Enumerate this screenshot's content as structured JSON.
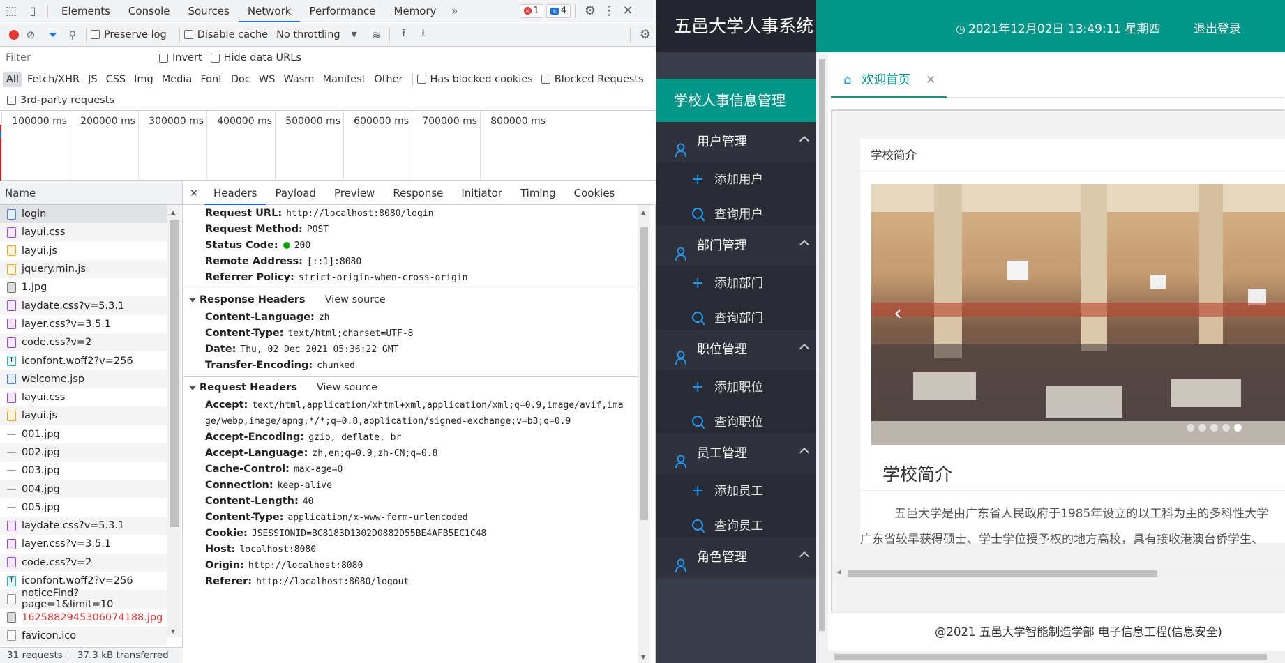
{
  "devtools": {
    "main_tabs": [
      "Elements",
      "Console",
      "Sources",
      "Network",
      "Performance",
      "Memory"
    ],
    "active_tab": "Network",
    "error_count": "1",
    "message_count": "4",
    "toolbar": {
      "preserve_log": "Preserve log",
      "disable_cache": "Disable cache",
      "throttling": "No throttling"
    },
    "filter": {
      "placeholder": "Filter",
      "invert": "Invert",
      "hide_data_urls": "Hide data URLs",
      "types": [
        "All",
        "Fetch/XHR",
        "JS",
        "CSS",
        "Img",
        "Media",
        "Font",
        "Doc",
        "WS",
        "Wasm",
        "Manifest",
        "Other"
      ],
      "active_type": "All",
      "has_blocked_cookies": "Has blocked cookies",
      "blocked_requests": "Blocked Requests",
      "third_party": "3rd-party requests"
    },
    "timeline_ticks": [
      "100000 ms",
      "200000 ms",
      "300000 ms",
      "400000 ms",
      "500000 ms",
      "600000 ms",
      "700000 ms",
      "800000 ms"
    ],
    "name_header": "Name",
    "requests": [
      {
        "name": "login",
        "type": "doc",
        "selected": true
      },
      {
        "name": "layui.css",
        "type": "css"
      },
      {
        "name": "layui.js",
        "type": "js"
      },
      {
        "name": "jquery.min.js",
        "type": "js"
      },
      {
        "name": "1.jpg",
        "type": "img"
      },
      {
        "name": "laydate.css?v=5.3.1",
        "type": "css"
      },
      {
        "name": "layer.css?v=3.5.1",
        "type": "css"
      },
      {
        "name": "code.css?v=2",
        "type": "css"
      },
      {
        "name": "iconfont.woff2?v=256",
        "type": "font"
      },
      {
        "name": "welcome.jsp",
        "type": "doc"
      },
      {
        "name": "layui.css",
        "type": "css"
      },
      {
        "name": "layui.js",
        "type": "js"
      },
      {
        "name": "001.jpg",
        "type": "line"
      },
      {
        "name": "002.jpg",
        "type": "line"
      },
      {
        "name": "003.jpg",
        "type": "line"
      },
      {
        "name": "004.jpg",
        "type": "line"
      },
      {
        "name": "005.jpg",
        "type": "line"
      },
      {
        "name": "laydate.css?v=5.3.1",
        "type": "css"
      },
      {
        "name": "layer.css?v=3.5.1",
        "type": "css"
      },
      {
        "name": "code.css?v=2",
        "type": "css"
      },
      {
        "name": "iconfont.woff2?v=256",
        "type": "font"
      },
      {
        "name": "noticeFind?page=1&limit=10",
        "type": "plain"
      },
      {
        "name": "1625882945306074188.jpg",
        "type": "img",
        "error": true
      },
      {
        "name": "favicon.ico",
        "type": "plain"
      }
    ],
    "status_requests": "31 requests",
    "status_transferred": "37.3 kB transferred",
    "detail_tabs": [
      "Headers",
      "Payload",
      "Preview",
      "Response",
      "Initiator",
      "Timing",
      "Cookies"
    ],
    "active_detail_tab": "Headers",
    "general": [
      {
        "k": "Request URL:",
        "v": "http://localhost:8080/login"
      },
      {
        "k": "Request Method:",
        "v": "POST"
      },
      {
        "k": "Status Code:",
        "v": "200"
      },
      {
        "k": "Remote Address:",
        "v": "[::1]:8080"
      },
      {
        "k": "Referrer Policy:",
        "v": "strict-origin-when-cross-origin"
      }
    ],
    "response_headers_title": "Response Headers",
    "request_headers_title": "Request Headers",
    "view_source": "View source",
    "response_headers": [
      {
        "k": "Content-Language:",
        "v": "zh"
      },
      {
        "k": "Content-Type:",
        "v": "text/html;charset=UTF-8"
      },
      {
        "k": "Date:",
        "v": "Thu, 02 Dec 2021 05:36:22 GMT"
      },
      {
        "k": "Transfer-Encoding:",
        "v": "chunked"
      }
    ],
    "request_headers": [
      {
        "k": "Accept:",
        "v": "text/html,application/xhtml+xml,application/xml;q=0.9,image/avif,ima"
      },
      {
        "k": "",
        "v": "ge/webp,image/apng,*/*;q=0.8,application/signed-exchange;v=b3;q=0.9"
      },
      {
        "k": "Accept-Encoding:",
        "v": "gzip, deflate, br"
      },
      {
        "k": "Accept-Language:",
        "v": "zh,en;q=0.9,zh-CN;q=0.8"
      },
      {
        "k": "Cache-Control:",
        "v": "max-age=0"
      },
      {
        "k": "Connection:",
        "v": "keep-alive"
      },
      {
        "k": "Content-Length:",
        "v": "40"
      },
      {
        "k": "Content-Type:",
        "v": "application/x-www-form-urlencoded"
      },
      {
        "k": "Cookie:",
        "v": "JSESSIONID=BC8183D1302D0882D55BE4AFB5EC1C48"
      },
      {
        "k": "Host:",
        "v": "localhost:8080"
      },
      {
        "k": "Origin:",
        "v": "http://localhost:8080"
      },
      {
        "k": "Referer:",
        "v": "http://localhost:8080/logout"
      }
    ]
  },
  "app": {
    "brand": "五邑大学人事系统",
    "datetime": "2021年12月02日  13:49:11  星期四",
    "logout": "退出登录",
    "nav_title": "学校人事信息管理",
    "groups": [
      {
        "label": "用户管理",
        "items": [
          {
            "icon": "plus-icon",
            "label": "添加用户"
          },
          {
            "icon": "search-icon",
            "label": "查询用户"
          }
        ]
      },
      {
        "label": "部门管理",
        "items": [
          {
            "icon": "plus-icon",
            "label": "添加部门"
          },
          {
            "icon": "search-icon",
            "label": "查询部门"
          }
        ]
      },
      {
        "label": "职位管理",
        "items": [
          {
            "icon": "plus-icon",
            "label": "添加职位"
          },
          {
            "icon": "search-icon",
            "label": "查询职位"
          }
        ]
      },
      {
        "label": "员工管理",
        "items": [
          {
            "icon": "plus-icon",
            "label": "添加员工"
          },
          {
            "icon": "search-icon",
            "label": "查询员工"
          }
        ]
      },
      {
        "label": "角色管理",
        "items": []
      }
    ],
    "tab_home": "欢迎首页",
    "card_header": "学校简介",
    "content_title": "学校简介",
    "content_line1": "五邑大学是由广东省人民政府于1985年设立的以工科为主的多科性大学",
    "content_line2": "广东省较早获得硕士、学士学位授予权的地方高校，具有接收港澳台侨学生、",
    "footer": "@2021 五邑大学智能制造学部 电子信息工程(信息安全)",
    "colors": {
      "accent": "#009688",
      "sidebar": "#393d49",
      "icon_blue": "#1e9fff"
    }
  }
}
